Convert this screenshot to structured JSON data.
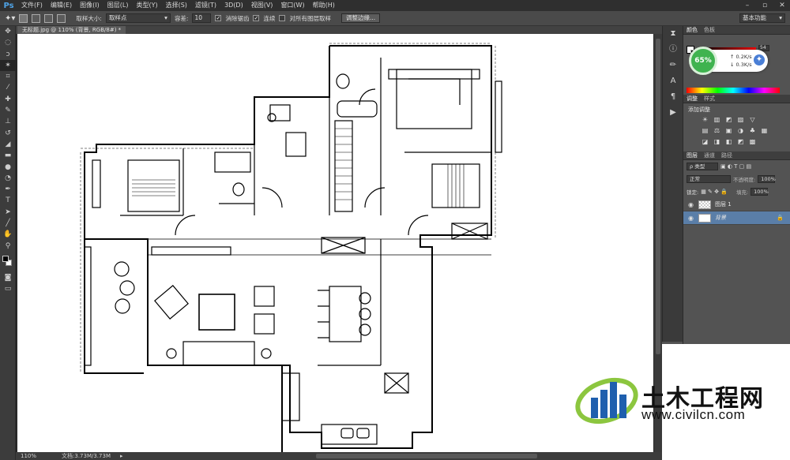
{
  "app": {
    "logo": "Ps"
  },
  "menu": [
    "文件(F)",
    "编辑(E)",
    "图像(I)",
    "图层(L)",
    "类型(Y)",
    "选择(S)",
    "滤镜(T)",
    "3D(D)",
    "视图(V)",
    "窗口(W)",
    "帮助(H)"
  ],
  "window_controls": [
    "–",
    "▫",
    "✕"
  ],
  "options": {
    "sample_size_label": "取样大小:",
    "sample_size_value": "取样点",
    "tolerance_label": "容差:",
    "tolerance_value": "10",
    "antialias_label": "消除锯齿",
    "contiguous_label": "连续",
    "all_layers_label": "对所有图层取样",
    "refine_edge_button": "调整边缘...",
    "workspace": "基本功能"
  },
  "document": {
    "tab_title": "无标题.jpg @ 110% (背景, RGB/8#) *",
    "zoom": "110%",
    "doc_size": "文档:3.73M/3.73M"
  },
  "panels": {
    "color_tabs": [
      "颜色",
      "色板"
    ],
    "color_value": "54",
    "adjust_tabs": [
      "调整",
      "样式"
    ],
    "adjust_title": "添加调整",
    "adjust_icons": [
      "☀",
      "▥",
      "◩",
      "▨",
      "▽",
      "",
      "▤",
      "⚖",
      "▣",
      "◑",
      "♣",
      "▦",
      "◪",
      "◨",
      "◧",
      "◩",
      "▩",
      ""
    ],
    "layers_tabs": [
      "图层",
      "通道",
      "路径"
    ],
    "kind_filter": "ρ 类型",
    "blend_mode": "正常",
    "opacity_label": "不透明度:",
    "opacity_value": "100%",
    "lock_label": "锁定:",
    "fill_label": "填充:",
    "fill_value": "100%",
    "layers": [
      {
        "name": "图层 1"
      },
      {
        "name": "背景"
      }
    ]
  },
  "network_widget": {
    "percent": "65%",
    "up": "0.2K/s",
    "down": "0.3K/s"
  },
  "watermark": {
    "title": "土木工程网",
    "url": "www.civilcn.com"
  },
  "colors": {
    "accent": "#5a7ea8",
    "ps_blue": "#4fa3e6",
    "widget_green": "#3fb34f"
  }
}
